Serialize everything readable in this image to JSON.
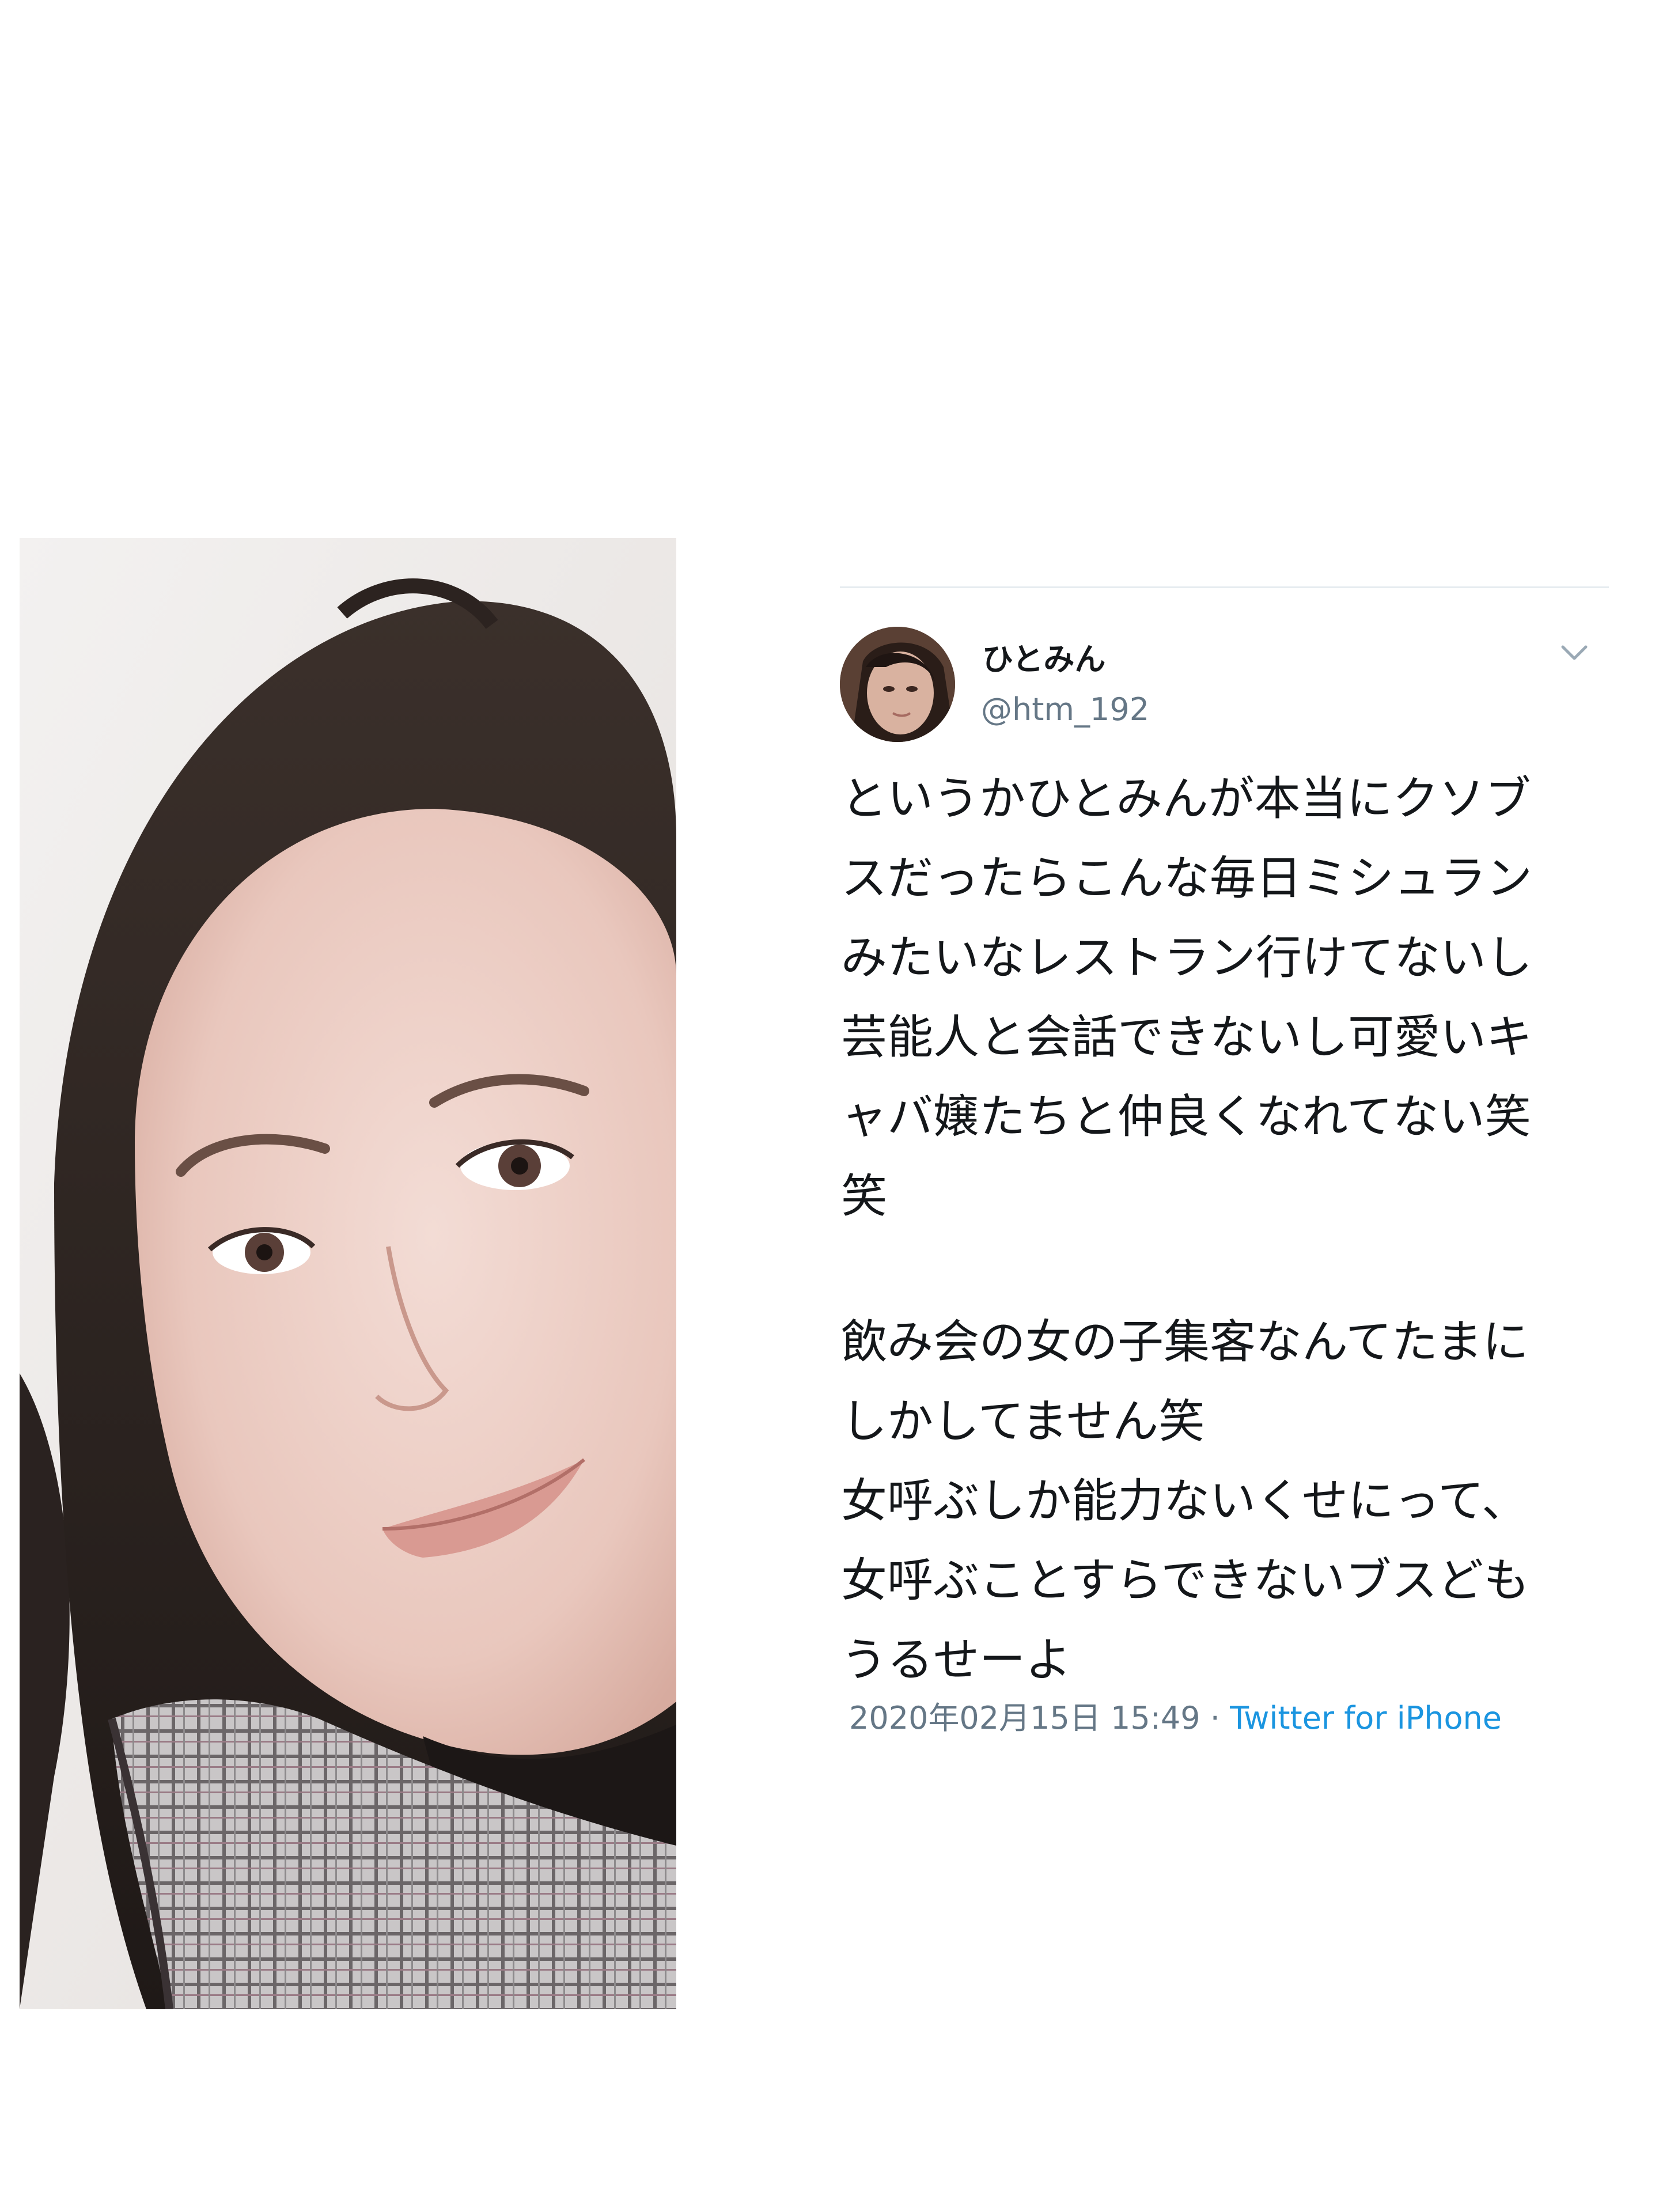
{
  "tweet": {
    "display_name": "ひとみん",
    "handle": "@htm_192",
    "body_lines": [
      "というかひとみんが本当にクソブ",
      "スだったらこんな毎日ミシュラン",
      "みたいなレストラン行けてないし",
      "芸能人と会話できないし可愛いキ",
      "ャバ嬢たちと仲良くなれてない笑",
      "笑"
    ],
    "body_lines_2": [
      "飲み会の女の子集客なんてたまに",
      "しかしてません笑",
      "女呼ぶしか能力ないくせにって、",
      "女呼ぶことすらできないブスども",
      "うるせーよ"
    ],
    "timestamp": "2020年02月15日 15:49",
    "separator": " · ",
    "source": "Twitter for iPhone"
  },
  "icons": {
    "menu": "chevron-down-icon"
  },
  "colors": {
    "text": "#14171a",
    "secondary": "#657786",
    "link": "#1b95e0",
    "divider": "#e6ecf0"
  }
}
